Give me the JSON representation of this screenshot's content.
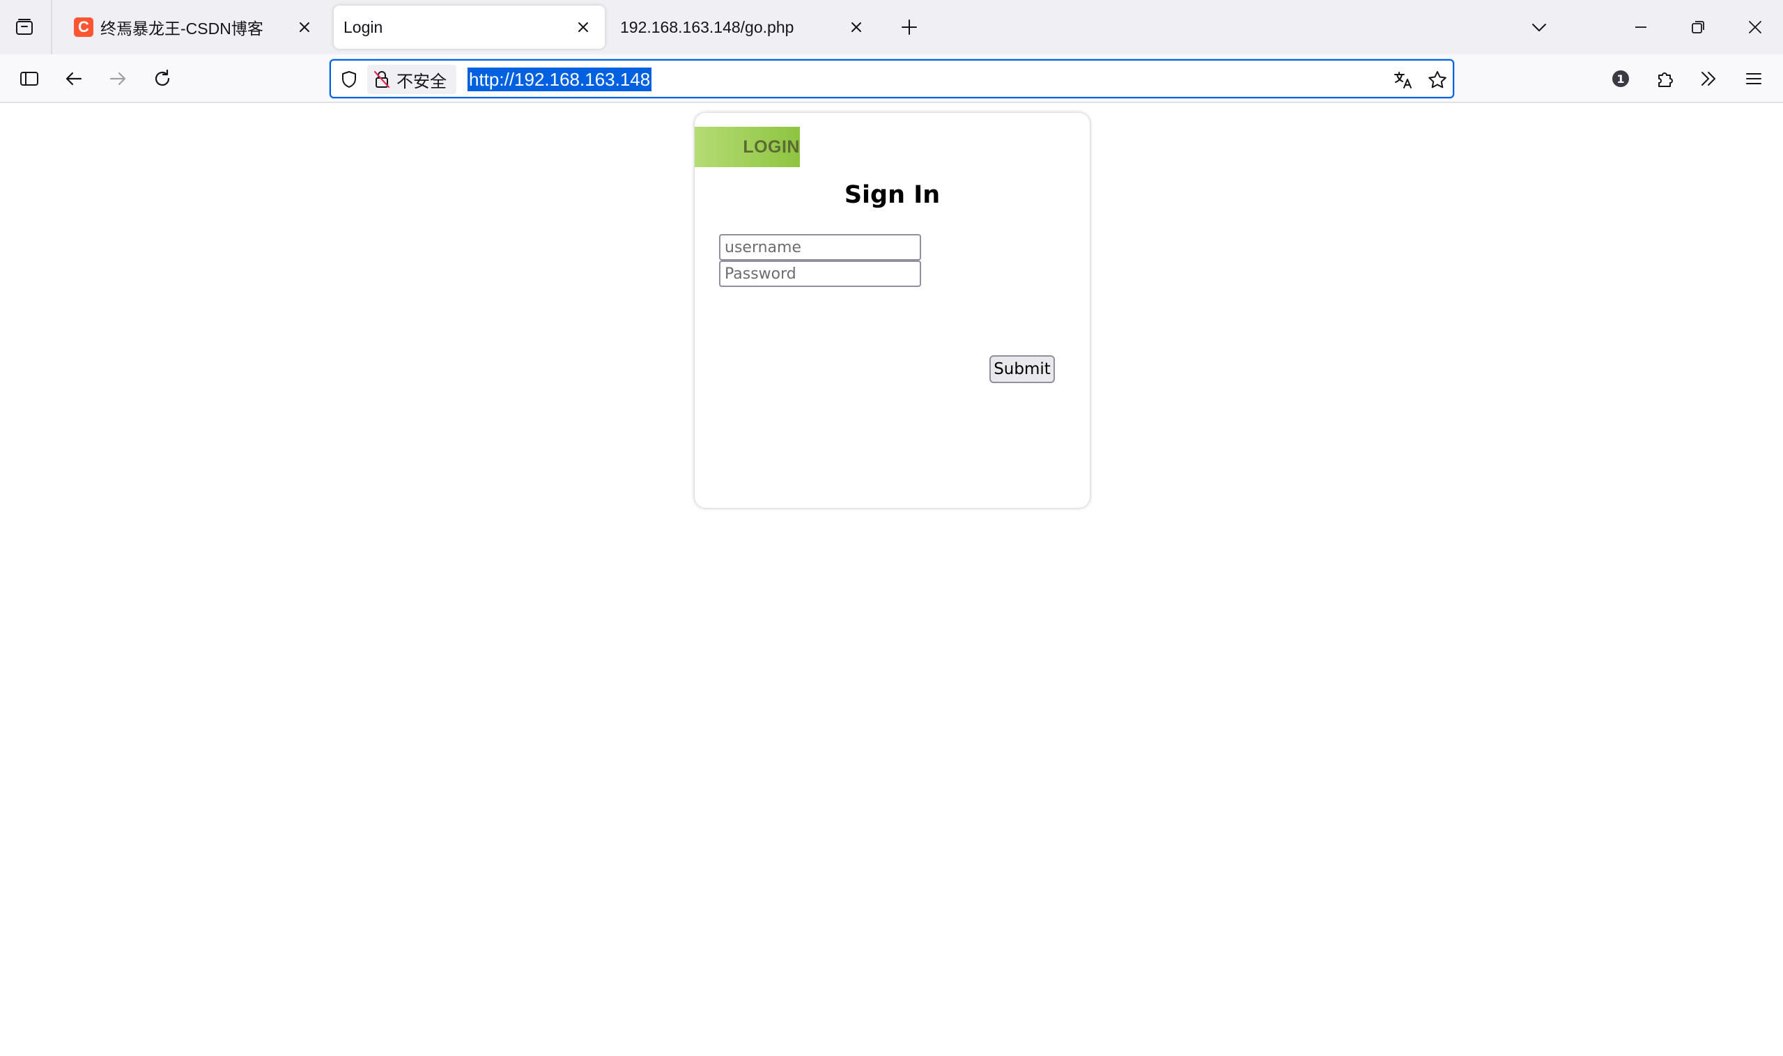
{
  "browser": {
    "tabs": [
      {
        "title": "终焉暴龙王-CSDN博客",
        "favicon_letter": "C",
        "active": false
      },
      {
        "title": "Login",
        "active": true
      },
      {
        "title": "192.168.163.148/go.php",
        "active": false
      }
    ],
    "urlbar": {
      "security_label": "不安全",
      "url": "http://192.168.163.148"
    },
    "badge_count": "1",
    "icons": {
      "tab_list": "tab-list-icon",
      "close_tab": "close-icon",
      "new_tab": "plus-icon",
      "all_tabs": "chevron-down-icon",
      "minimize": "minimize-icon",
      "restore": "restore-icon",
      "close_window": "close-icon",
      "sidebar": "sidebar-icon",
      "back": "back-arrow-icon",
      "forward": "forward-arrow-icon",
      "reload": "reload-icon",
      "shield": "shield-icon",
      "insecure_lock": "insecure-lock-icon",
      "translate": "translate-icon",
      "bookmark": "star-icon",
      "password_manager": "password-badge-icon",
      "extensions": "puzzle-icon",
      "overflow": "chevron-double-right-icon",
      "menu": "hamburger-menu-icon"
    },
    "accent_color": "#0061e0",
    "favicon_color": "#fc5531"
  },
  "page": {
    "ribbon_label": "LOGIN",
    "ribbon_color": "#8ec441",
    "heading": "Sign In",
    "username_placeholder": "username",
    "password_placeholder": "Password",
    "submit_label": "Submit"
  }
}
